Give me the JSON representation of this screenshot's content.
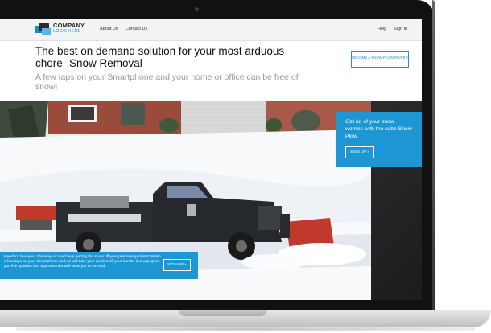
{
  "logo": {
    "line1": "COMPANY",
    "line2": "LOGO HERE"
  },
  "nav": {
    "about": "About Us",
    "contact": "Contact Us",
    "help": "Help",
    "signin": "Sign In"
  },
  "hero": {
    "title": "The best on demand solution for your most arduous chore- Snow Removal",
    "subtitle": "A few taps on your Smartphone and your home or office can be free of snow!",
    "driver_button": "BECOME A SNOW PLOW DRIVER"
  },
  "cta": {
    "text": "Get rid of your snow worries with the cube Snow Plow",
    "button": "SIGN UP"
  },
  "bottom": {
    "text": "Need to clear your driveway or need help getting the snow off your precious gardens? Make a few taps on your Smartphone and we will take your worries off your hands. Our app gives you live updates and a picture of a well done job at the end.",
    "button": "SIGN UP"
  },
  "icons": {
    "chevron": "»"
  },
  "colors": {
    "accent": "#1d97d4",
    "title": "#111111",
    "subtitle": "#9a9a9a"
  }
}
